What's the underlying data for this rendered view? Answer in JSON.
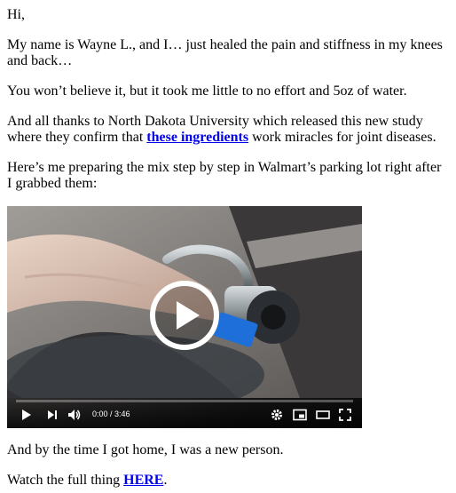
{
  "email": {
    "greeting": "Hi,",
    "intro": "My name is Wayne L., and I… just healed the pain and stiffness in my knees and back…",
    "claim": "You won’t believe it, but it took me little to no effort and 5oz of water.",
    "study_before": "And all thanks to North Dakota University which released this new study where they confirm that ",
    "study_link": "these ingredients",
    "study_after": " work miracles for joint diseases.",
    "walmart": "Here’s me preparing the mix step by step in Walmart’s parking lot right after I grabbed them:",
    "after_video": "And by the time I got home, I was a new person.",
    "watch_before": "Watch the full thing ",
    "watch_link": "HERE",
    "watch_after": "."
  },
  "video": {
    "current_time": "0:00",
    "duration": "3:46",
    "time_display": "0:00 / 3:46",
    "progress_fraction": 0,
    "icons": [
      "play-icon",
      "next-icon",
      "volume-icon",
      "settings-icon",
      "miniplayer-icon",
      "theater-icon",
      "fullscreen-icon"
    ]
  },
  "colors": {
    "link": "#0000ee",
    "progress": "#ff0000",
    "accent_cap": "#1e6fd9"
  }
}
